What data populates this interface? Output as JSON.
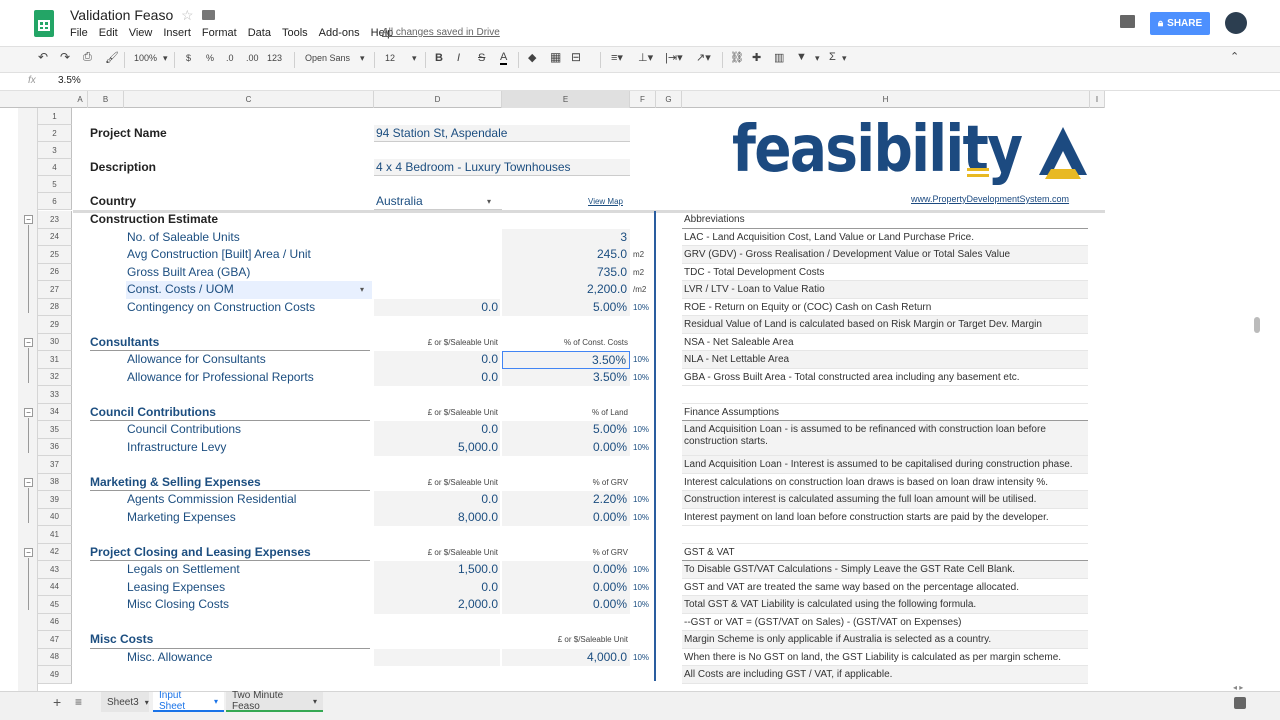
{
  "app": {
    "title": "Validation Feaso",
    "save_status": "All changes saved in Drive",
    "share_label": "SHARE"
  },
  "menu": [
    "File",
    "Edit",
    "View",
    "Insert",
    "Format",
    "Data",
    "Tools",
    "Add-ons",
    "Help"
  ],
  "toolbar": {
    "zoom": "100%",
    "currency": "$",
    "percent": "%",
    "dec_less": ".0",
    "dec_more": ".00",
    "format_more": "123",
    "font": "Open Sans",
    "font_size": "12",
    "bold": "B",
    "italic": "I",
    "strike": "S",
    "textcolor": "A",
    "sigma": "Σ"
  },
  "formula": {
    "fx": "fx",
    "value": "3.5%"
  },
  "columns": [
    "A",
    "B",
    "C",
    "D",
    "E",
    "F",
    "G",
    "H",
    "I"
  ],
  "logo": {
    "text": "feasibility",
    "url": "www.PropertyDevelopmentSystem.com"
  },
  "header_rows": [
    {
      "row": "1"
    },
    {
      "row": "2",
      "label": "Project Name",
      "value": "94 Station St, Aspendale"
    },
    {
      "row": "3"
    },
    {
      "row": "4",
      "label": "Description",
      "value": "4 x 4 Bedroom - Luxury Townhouses"
    },
    {
      "row": "5"
    },
    {
      "row": "6",
      "label": "Country",
      "value": "Australia",
      "link": "View Map"
    }
  ],
  "construction": {
    "title": "Construction Estimate",
    "rows": [
      {
        "row": "24",
        "label": "No. of Saleable Units",
        "e": "3",
        "f": ""
      },
      {
        "row": "25",
        "label": "Avg Construction [Built] Area / Unit",
        "e": "245.0",
        "f": "m2"
      },
      {
        "row": "26",
        "label": "Gross Built Area (GBA)",
        "e": "735.0",
        "f": "m2"
      },
      {
        "row": "27",
        "label": "Const. Costs / UOM",
        "e": "2,200.0",
        "f": "/m2"
      },
      {
        "row": "28",
        "label": "Contingency on Construction Costs",
        "d": "0.0",
        "e": "5.00%",
        "f": "10%"
      }
    ]
  },
  "sections": [
    {
      "row": "30",
      "title": "Consultants",
      "dh": "£ or $/Saleable Unit",
      "eh": "% of Const. Costs",
      "rows": [
        {
          "row": "31",
          "label": "Allowance for Consultants",
          "d": "0.0",
          "e": "3.50%",
          "f": "10%"
        },
        {
          "row": "32",
          "label": "Allowance for Professional Reports",
          "d": "0.0",
          "e": "3.50%",
          "f": "10%"
        }
      ]
    },
    {
      "row": "34",
      "title": "Council Contributions",
      "dh": "£ or $/Saleable Unit",
      "eh": "% of Land",
      "rows": [
        {
          "row": "35",
          "label": "Council Contributions",
          "d": "0.0",
          "e": "5.00%",
          "f": "10%"
        },
        {
          "row": "36",
          "label": "Infrastructure Levy",
          "d": "5,000.0",
          "e": "0.00%",
          "f": "10%"
        }
      ]
    },
    {
      "row": "38",
      "title": "Marketing & Selling Expenses",
      "dh": "£ or $/Saleable Unit",
      "eh": "% of GRV",
      "rows": [
        {
          "row": "39",
          "label": "Agents Commission Residential",
          "d": "0.0",
          "e": "2.20%",
          "f": "10%"
        },
        {
          "row": "40",
          "label": "Marketing Expenses",
          "d": "8,000.0",
          "e": "0.00%",
          "f": "10%"
        }
      ]
    },
    {
      "row": "42",
      "title": "Project Closing and Leasing Expenses",
      "dh": "£ or $/Saleable Unit",
      "eh": "% of GRV",
      "rows": [
        {
          "row": "43",
          "label": "Legals on Settlement",
          "d": "1,500.0",
          "e": "0.00%",
          "f": "10%"
        },
        {
          "row": "44",
          "label": "Leasing Expenses",
          "d": "0.0",
          "e": "0.00%",
          "f": "10%"
        },
        {
          "row": "45",
          "label": "Misc Closing Costs",
          "d": "2,000.0",
          "e": "0.00%",
          "f": "10%"
        }
      ]
    },
    {
      "row": "47",
      "title": "Misc Costs",
      "dh": "",
      "eh": "£ or $/Saleable Unit",
      "rows": [
        {
          "row": "48",
          "label": "Misc. Allowance",
          "d": "",
          "e": "4,000.0",
          "f": "10%"
        }
      ]
    }
  ],
  "blank_rows": [
    "29",
    "33",
    "37",
    "41",
    "46",
    "49"
  ],
  "notes": [
    "Abbreviations",
    "LAC - Land Acquisition Cost, Land Value or Land Purchase Price.",
    "GRV (GDV) - Gross Realisation / Development Value or Total Sales Value",
    "TDC - Total Development Costs",
    "LVR / LTV - Loan to Value Ratio",
    "ROE - Return on Equity or (COC) Cash on Cash Return",
    "Residual Value of Land is calculated based on Risk Margin or Target Dev. Margin",
    "NSA - Net Saleable Area",
    "NLA - Net Lettable Area",
    "GBA - Gross Built Area - Total constructed area including any basement etc.",
    "",
    "Finance Assumptions",
    "Land Acquisition Loan - is assumed to be refinanced with construction loan before construction starts.",
    "",
    "Land Acquisition Loan - Interest is assumed to be capitalised during construction phase.",
    "Interest calculations on construction loan draws is based on loan draw intensity %.",
    "Construction interest is calculated assuming the full loan amount will be utilised.",
    "Interest payment on land loan before construction starts are paid by the developer.",
    "",
    "GST & VAT",
    "To Disable GST/VAT Calculations - Simply Leave the GST Rate Cell Blank.",
    "GST and VAT are treated the same way based on the percentage allocated.",
    "Total GST & VAT Liability is calculated using the following formula.",
    "--GST or VAT = (GST/VAT on Sales) - (GST/VAT on Expenses)",
    "Margin Scheme is only applicable if Australia is selected as a country.",
    "When there is No GST on land, the GST Liability is calculated as per margin scheme.",
    "All Costs are including GST / VAT, if applicable."
  ],
  "sheets": [
    "Sheet3",
    "Input Sheet",
    "Two Minute Feaso"
  ],
  "colors": {
    "accent": "#1c4e80",
    "tab_active": "#1a73e8",
    "tab_green": "#34a853",
    "logo_yellow": "#e8b923"
  }
}
